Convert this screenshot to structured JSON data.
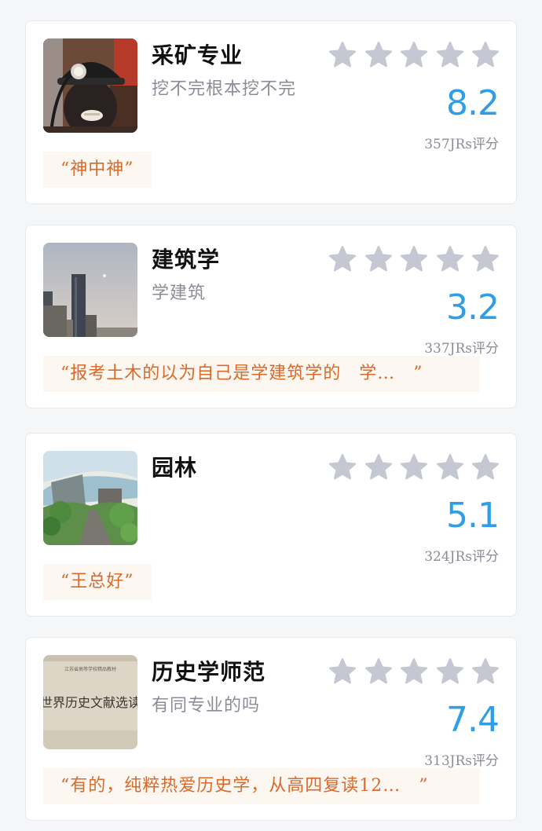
{
  "cards": [
    {
      "title": "采矿专业",
      "subtitle": "挖不完根本挖不完",
      "score": "8.2",
      "count": "357JRs评分",
      "quote": "“神中神”",
      "thumb_icon": "coal-miner-photo"
    },
    {
      "title": "建筑学",
      "subtitle": "学建筑",
      "score": "3.2",
      "count": "337JRs评分",
      "quote": "“报考土木的以为自己是学建筑学的　学…　”",
      "thumb_icon": "city-skyline-photo"
    },
    {
      "title": "园林",
      "subtitle": "",
      "score": "5.1",
      "count": "324JRs评分",
      "quote": "“王总好”",
      "thumb_icon": "landscape-painting"
    },
    {
      "title": "历史学师范",
      "subtitle": "有同专业的吗",
      "score": "7.4",
      "count": "313JRs评分",
      "quote": "“有的，纯粹热爱历史学，从高四复读12…　”",
      "thumb_icon": "history-book-cover",
      "thumb_text_top": "江苏省高等学校精品教材",
      "thumb_text_main": "世界历史文献选读"
    }
  ],
  "colors": {
    "score": "#2f9ee6",
    "quote_text": "#d96a2b",
    "quote_bg": "#fcf7f1",
    "star": "#c5c8d2"
  }
}
